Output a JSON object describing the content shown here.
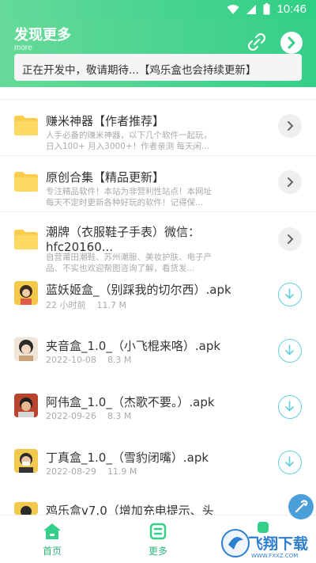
{
  "status_bar": {
    "time": "10:46"
  },
  "header": {
    "title": "发现更多",
    "subtitle": "more"
  },
  "notice": "正在开发中，敬请期待...【鸡乐盒也会持续更新】",
  "folders": [
    {
      "title": "赚米神器【作者推荐】",
      "desc": "人手必备的赚米神器，以下几个软件一起玩，日入100+ 月入3000+！作者亲测 每天闲..."
    },
    {
      "title": "原创合集【精品更新】",
      "desc": "专注精品软件！本站为非营利性站点！本网址每天不定时更新各种好玩的软件！记得保..."
    },
    {
      "title": "潮牌（衣服鞋子手表）微信：hfc20160...",
      "desc": "自营莆田潮鞋、苏州潮服、美妆护肤、电子产品、不实也欢迎帮图咨询了解，看货发..."
    }
  ],
  "apks": [
    {
      "name": "蓝妖姬盒_（别踩我的切尔西）.apk",
      "time": "22 小时前",
      "size": "11.7 M"
    },
    {
      "name": "夹音盒_1.0_（小飞棍来咯）.apk",
      "time": "2022-10-08",
      "size": "8.3 M"
    },
    {
      "name": "阿伟盒_1.0_（杰歌不要。）.apk",
      "time": "2022-09-26",
      "size": "8.3 M"
    },
    {
      "name": "丁真盒_1.0_（雪豹闭嘴）.apk",
      "time": "2022-08-29",
      "size": "11.9 M"
    },
    {
      "name": "鸡乐盒v7.0（增加充电提示、头",
      "time": "",
      "size": ""
    }
  ],
  "nav": {
    "home": "首页",
    "more": "更多"
  },
  "watermark": {
    "text": "飞翔下载",
    "url": "WWW.FXXZ.COM"
  },
  "colors": {
    "accent": "#34cf89",
    "download": "#62cfe0"
  }
}
